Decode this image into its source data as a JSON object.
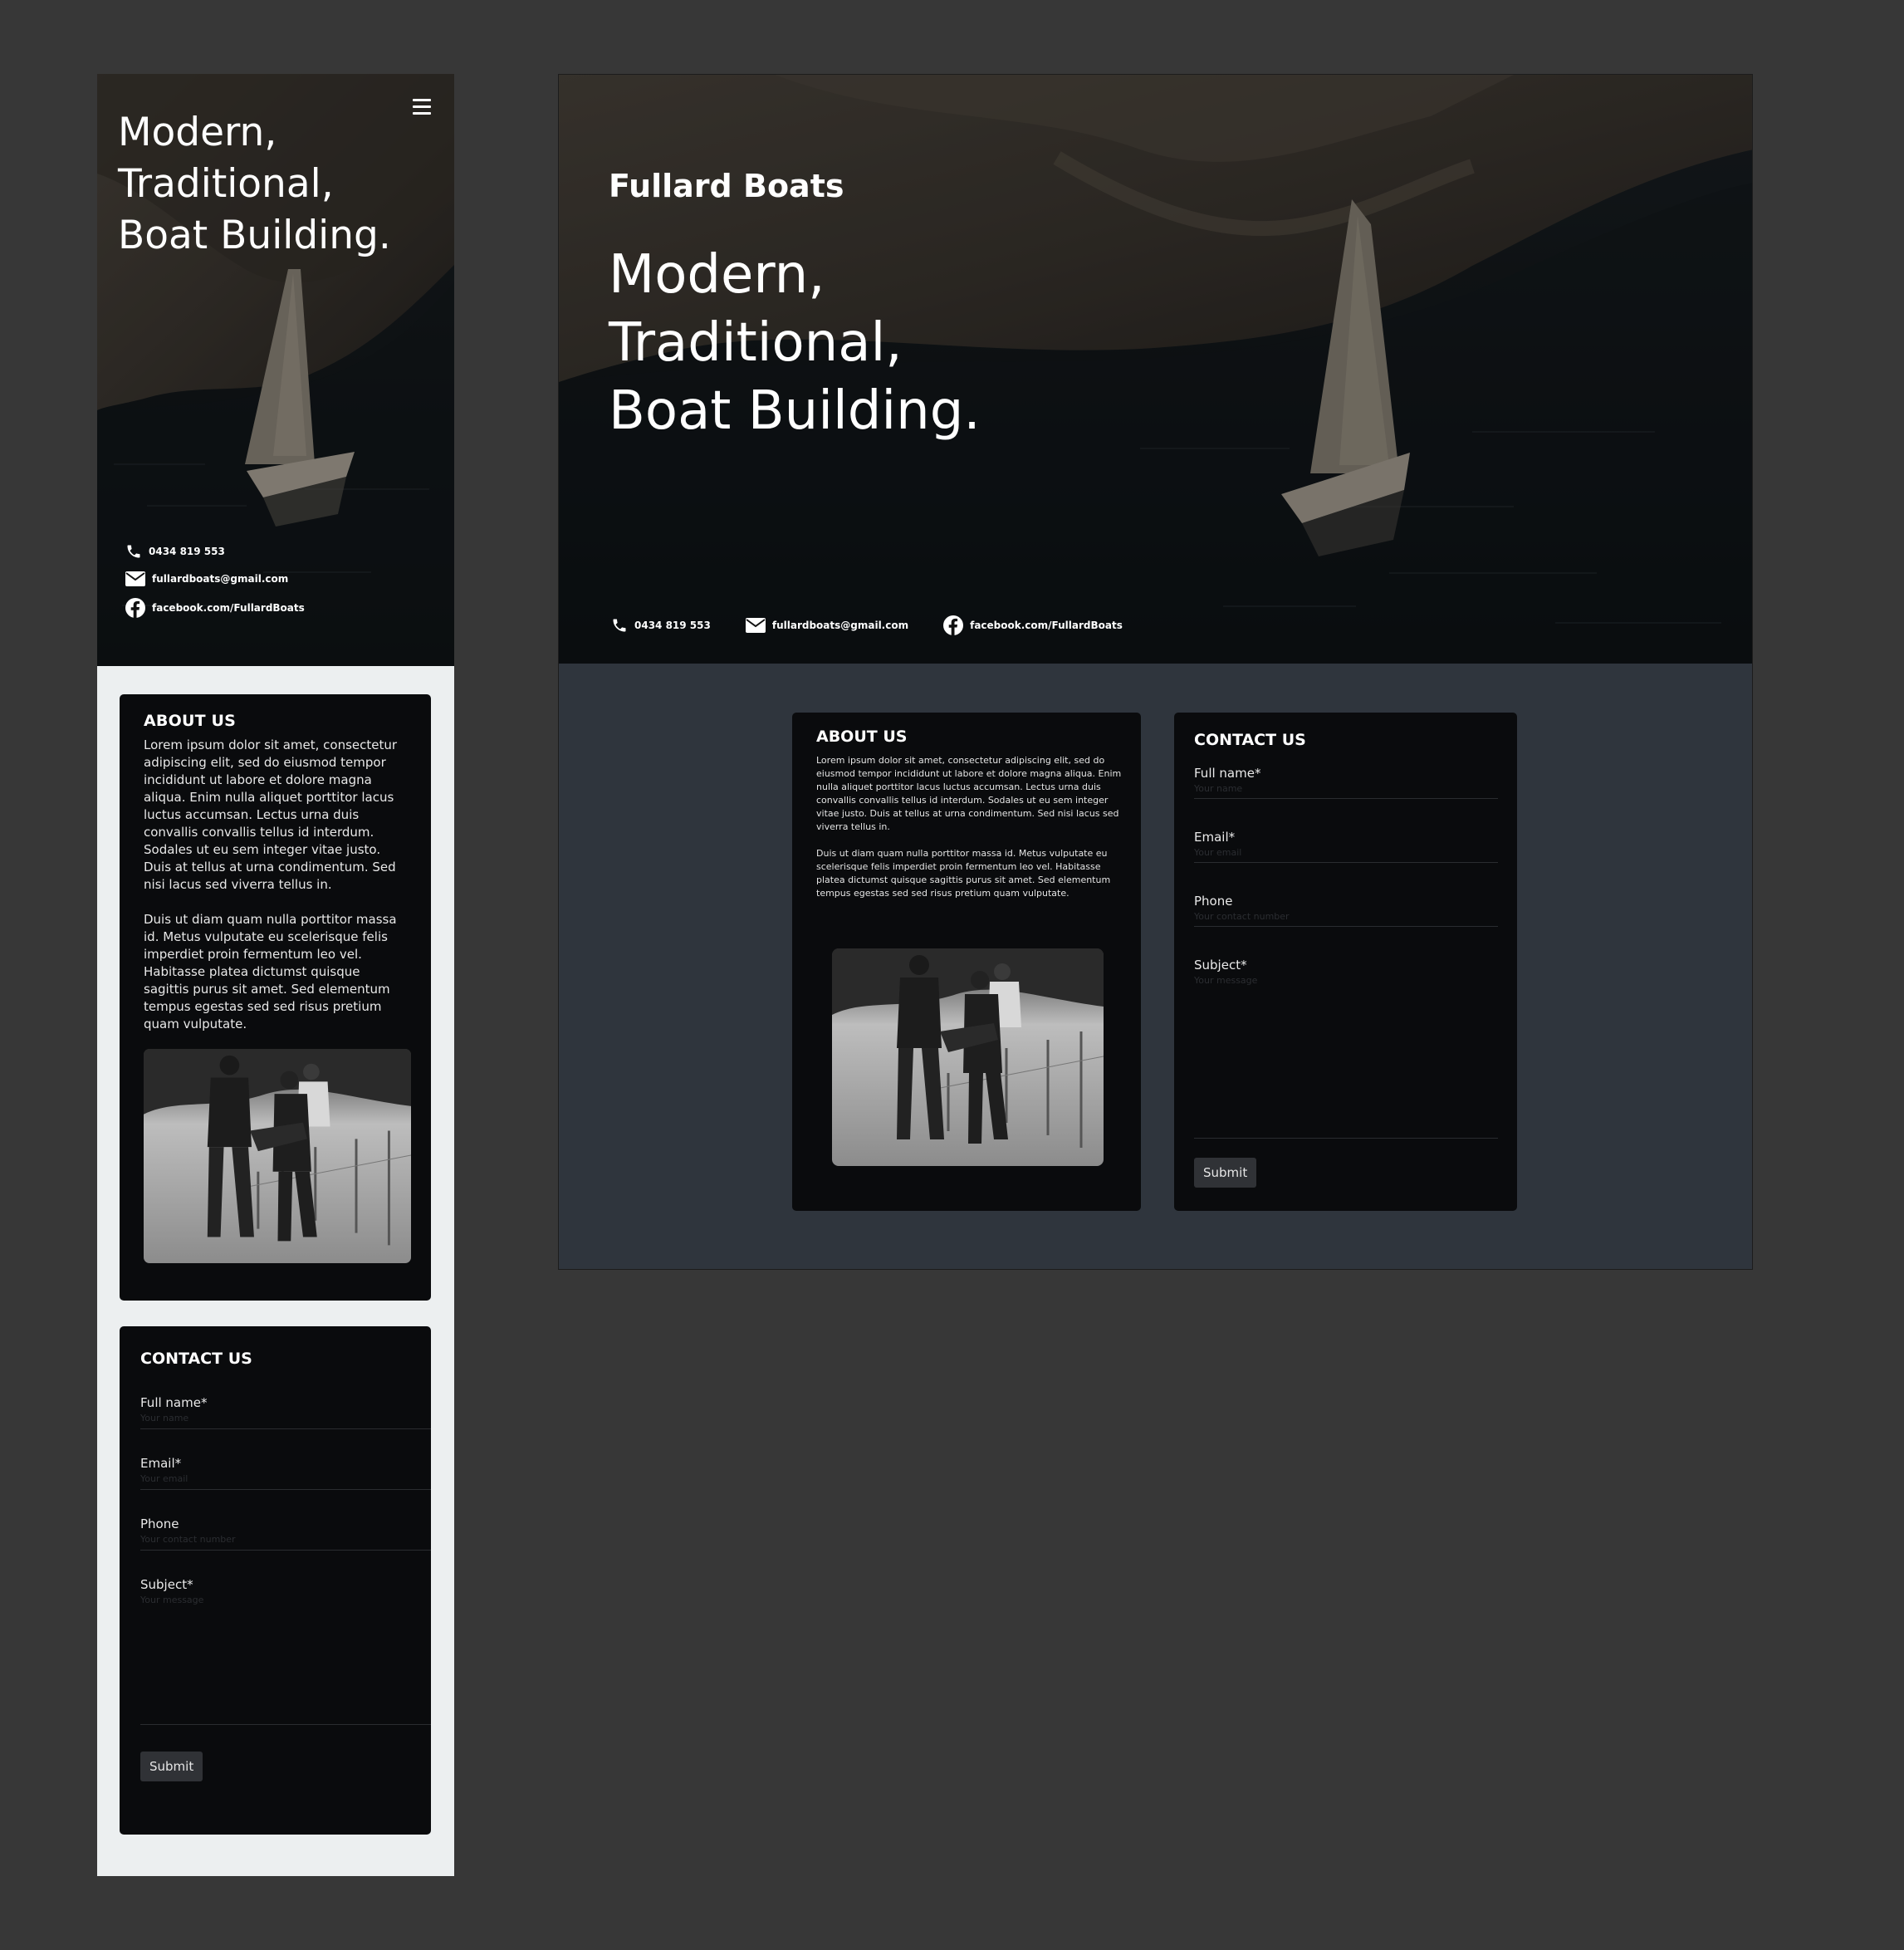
{
  "brand": "Fullard Boats",
  "tagline": [
    "Modern,",
    "Traditional,",
    "Boat Building."
  ],
  "contacts": {
    "phone": "0434 819 553",
    "email": "fullardboats@gmail.com",
    "facebook": "facebook.com/FullardBoats"
  },
  "about": {
    "title": "ABOUT US",
    "paragraphs": [
      "Lorem ipsum dolor sit amet, consectetur adipiscing elit, sed do eiusmod tempor incididunt ut labore et dolore magna aliqua. Enim nulla aliquet porttitor lacus luctus accumsan. Lectus urna duis convallis convallis tellus id interdum. Sodales ut eu sem integer vitae justo. Duis at tellus at urna condimentum. Sed nisi lacus sed viverra tellus in.",
      "Duis ut diam quam nulla porttitor massa id. Metus vulputate eu scelerisque felis imperdiet proin fermentum leo vel. Habitasse platea dictumst quisque sagittis purus sit amet. Sed elementum tempus egestas sed sed risus pretium quam vulputate."
    ]
  },
  "contact_form": {
    "title": "CONTACT US",
    "fields": [
      {
        "label": "Full name*",
        "placeholder": "Your name"
      },
      {
        "label": "Email*",
        "placeholder": "Your email"
      },
      {
        "label": "Phone",
        "placeholder": "Your contact number"
      },
      {
        "label": "Subject*",
        "placeholder": "Your message"
      }
    ],
    "submit": "Submit"
  },
  "icons": {
    "menu": "hamburger-menu-icon",
    "phone": "phone-icon",
    "email": "envelope-icon",
    "facebook": "facebook-icon"
  },
  "colors": {
    "canvas": "#373737",
    "mobile_bg": "#eceff0",
    "desktop_bg": "#2f353d",
    "card": "#0a0b0d",
    "button": "#303236"
  }
}
